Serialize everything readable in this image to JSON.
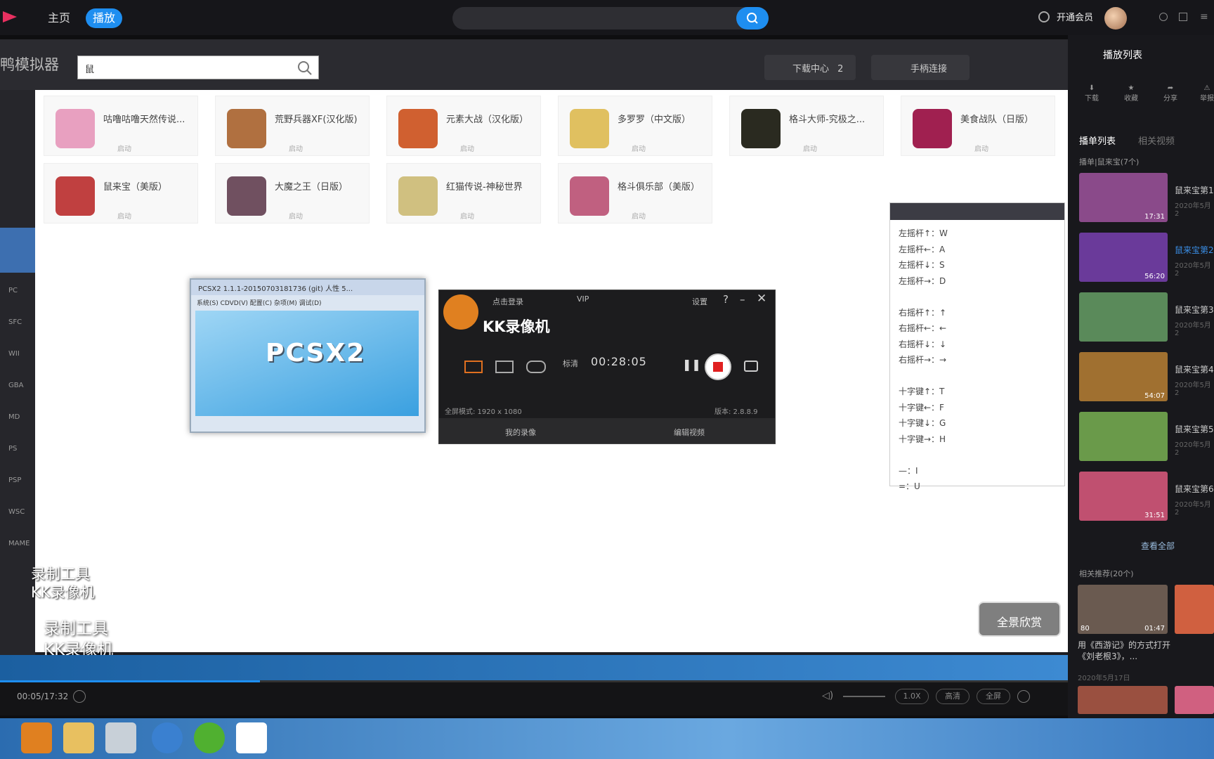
{
  "top_nav": {
    "home": "主页",
    "play": "播放",
    "vip": "开通会员"
  },
  "emulator": {
    "title": "鸭模拟器",
    "search_value": "鼠",
    "download_center": "下载中心",
    "download_count": "2",
    "gamepad": "手柄连接",
    "side_labels": [
      "PC",
      "SFC",
      "WII",
      "GBA",
      "MD",
      "PS",
      "PSP",
      "WSC",
      "MAME"
    ],
    "games": [
      {
        "name": "咕噜咕噜天然传说...",
        "tag": "启动",
        "color": "#e8a0c0"
      },
      {
        "name": "荒野兵器XF(汉化版)",
        "tag": "启动",
        "color": "#b07040"
      },
      {
        "name": "元素大战（汉化版）",
        "tag": "启动",
        "color": "#d06030"
      },
      {
        "name": "多罗罗（中文版）",
        "tag": "启动",
        "color": "#e0c060"
      },
      {
        "name": "格斗大师-究极之...",
        "tag": "启动",
        "color": "#2a2a20"
      },
      {
        "name": "美食战队（日版）",
        "tag": "启动",
        "color": "#a02050"
      },
      {
        "name": "鼠来宝（美版）",
        "tag": "启动",
        "color": "#c04040"
      },
      {
        "name": "大魔之王（日版）",
        "tag": "启动",
        "color": "#705060"
      },
      {
        "name": "红猫传说-神秘世界",
        "tag": "启动",
        "color": "#d0c080"
      },
      {
        "name": "格斗俱乐部（美版）",
        "tag": "启动",
        "color": "#c06080"
      }
    ]
  },
  "pcsx2": {
    "title": "PCSX2 1.1.1-20150703181736 (git) 人性 5...",
    "logo": "PCSX2",
    "menu": "系统(S)  CDVD(V)  配置(C)  杂项(M)  调试(D)"
  },
  "kk": {
    "login": "点击登录",
    "vip": "VIP",
    "settings": "设置",
    "title": "KK录像机",
    "quality": "标清",
    "time": "00:28:05",
    "mode": "全屏模式: 1920 x 1080",
    "version": "版本: 2.8.8.9",
    "my_recordings": "我的录像",
    "edit_video": "编辑视频"
  },
  "keymap": [
    "左摇杆↑：W",
    "左摇杆←：A",
    "左摇杆↓：S",
    "左摇杆→：D",
    "",
    "右摇杆↑：↑",
    "右摇杆←：←",
    "右摇杆↓：↓",
    "右摇杆→：→",
    "",
    "十字键↑：T",
    "十字键←：F",
    "十字键↓：G",
    "十字键→：H",
    "",
    "—：I",
    "=：U"
  ],
  "watermark": {
    "line1": "录制工具",
    "line2": "KK录像机"
  },
  "panorama": "全景欣赏",
  "player": {
    "time": "00:05/17:32",
    "speed": "1.0X",
    "quality": "高清",
    "fullscreen": "全屏"
  },
  "right_panel": {
    "title": "播放列表",
    "icons": [
      "下载",
      "收藏",
      "分享",
      "举报"
    ],
    "tab_active": "播单列表",
    "tab_other": "相关视频",
    "playlist_label": "播单|鼠来宝(7个)",
    "episodes": [
      {
        "title": "鼠来宝第1",
        "date": "2020年5月2",
        "dur": "17:31",
        "color": "#8a4a8a"
      },
      {
        "title": "鼠来宝第2",
        "date": "2020年5月2",
        "dur": "56:20",
        "color": "#6a3a9a"
      },
      {
        "title": "鼠来宝第3",
        "date": "2020年5月2",
        "dur": "",
        "color": "#5a8a5a"
      },
      {
        "title": "鼠来宝第4",
        "date": "2020年5月2",
        "dur": "54:07",
        "color": "#a07030"
      },
      {
        "title": "鼠来宝第5",
        "date": "2020年5月2",
        "dur": "",
        "color": "#6a9a4a"
      },
      {
        "title": "鼠来宝第6",
        "date": "2020年5月2",
        "dur": "31:51",
        "color": "#c05070"
      }
    ],
    "view_all": "查看全部",
    "related_label": "相关推荐(20个)",
    "related": [
      {
        "title": "用《西游记》的方式打开《刘老根3》，...",
        "count": "80",
        "dur": "01:47",
        "date": "2020年5月17日"
      }
    ]
  }
}
